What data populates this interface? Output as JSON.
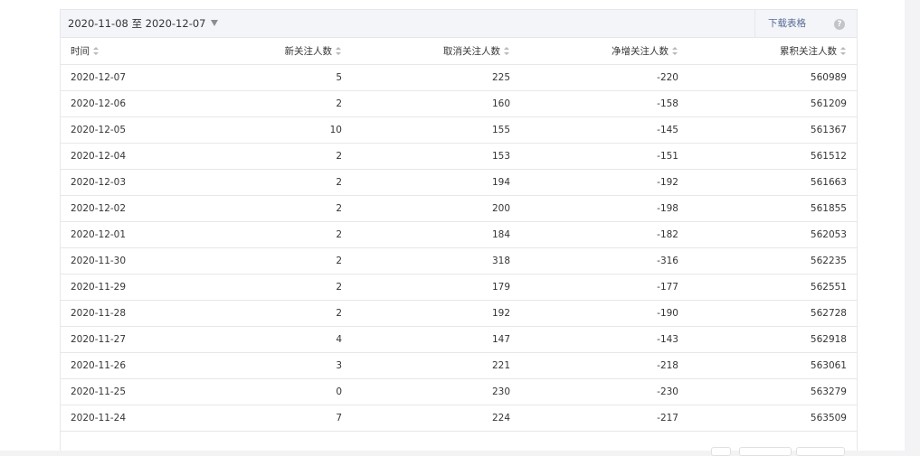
{
  "toolbar": {
    "date_range": "2020-11-08 至 2020-12-07",
    "download_label": "下载表格",
    "help_label": "?"
  },
  "table": {
    "columns": [
      "时间",
      "新关注人数",
      "取消关注人数",
      "净增关注人数",
      "累积关注人数"
    ],
    "rows": [
      [
        "2020-12-07",
        "5",
        "225",
        "-220",
        "560989"
      ],
      [
        "2020-12-06",
        "2",
        "160",
        "-158",
        "561209"
      ],
      [
        "2020-12-05",
        "10",
        "155",
        "-145",
        "561367"
      ],
      [
        "2020-12-04",
        "2",
        "153",
        "-151",
        "561512"
      ],
      [
        "2020-12-03",
        "2",
        "194",
        "-192",
        "561663"
      ],
      [
        "2020-12-02",
        "2",
        "200",
        "-198",
        "561855"
      ],
      [
        "2020-12-01",
        "2",
        "184",
        "-182",
        "562053"
      ],
      [
        "2020-11-30",
        "2",
        "318",
        "-316",
        "562235"
      ],
      [
        "2020-11-29",
        "2",
        "179",
        "-177",
        "562551"
      ],
      [
        "2020-11-28",
        "2",
        "192",
        "-190",
        "562728"
      ],
      [
        "2020-11-27",
        "4",
        "147",
        "-143",
        "562918"
      ],
      [
        "2020-11-26",
        "3",
        "221",
        "-218",
        "563061"
      ],
      [
        "2020-11-25",
        "0",
        "230",
        "-230",
        "563279"
      ],
      [
        "2020-11-24",
        "7",
        "224",
        "-217",
        "563509"
      ]
    ]
  },
  "colors": {
    "link": "#576b95",
    "border": "#e7e7eb",
    "toolbar_bg": "#f4f5f9",
    "page_bg": "#f3f3f5"
  }
}
